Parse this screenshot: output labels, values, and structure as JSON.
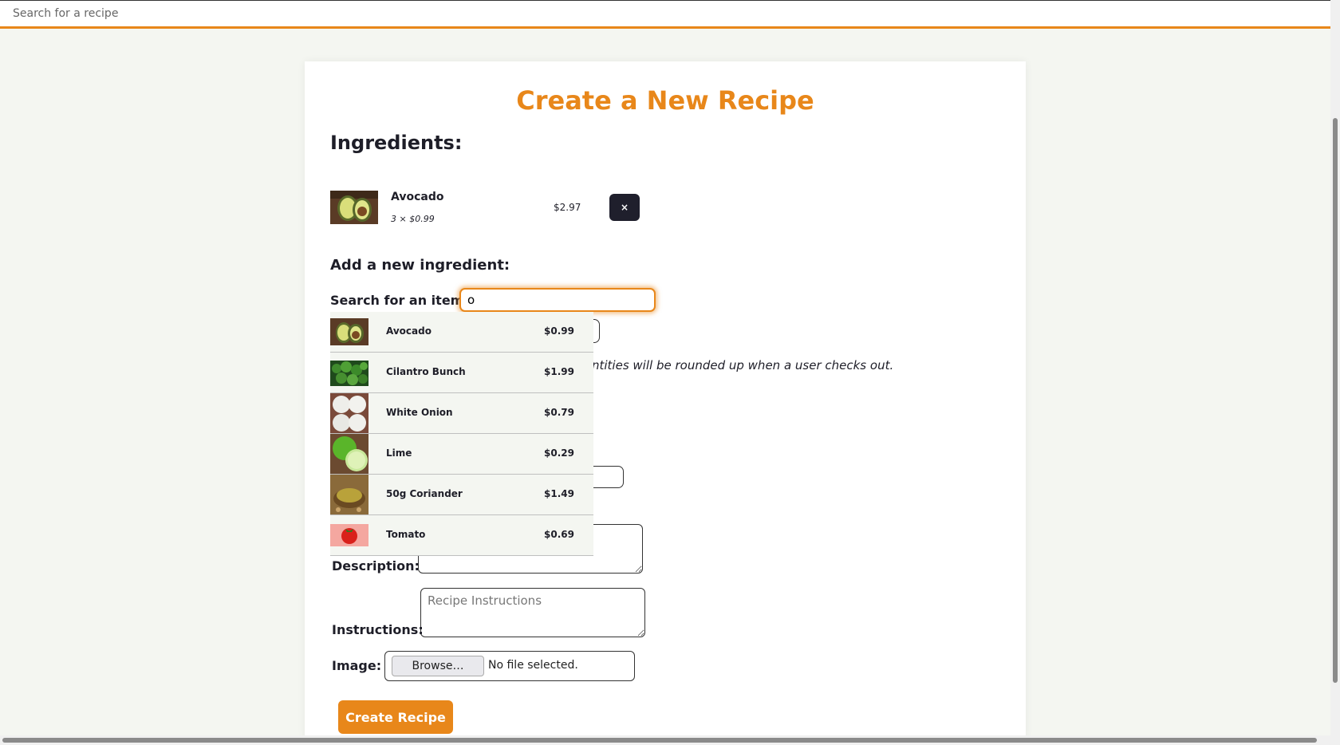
{
  "topbar": {
    "search_placeholder": "Search for a recipe"
  },
  "page": {
    "title": "Create a New Recipe"
  },
  "ingredients": {
    "heading": "Ingredients:",
    "items": [
      {
        "name": "Avocado",
        "quantity_line": "3 × $0.99",
        "total": "$2.97",
        "remove_label": "×",
        "image": "avocado"
      }
    ]
  },
  "add_ingredient": {
    "heading": "Add a new ingredient:",
    "search_label": "Search for an item:",
    "search_value": "o",
    "note_partial": "ntities will be rounded up when a user checks out."
  },
  "dropdown": {
    "items": [
      {
        "name": "Avocado",
        "price": "$0.99",
        "image": "avocado"
      },
      {
        "name": "Cilantro Bunch",
        "price": "$1.99",
        "image": "cilantro"
      },
      {
        "name": "White Onion",
        "price": "$0.79",
        "image": "onion"
      },
      {
        "name": "Lime",
        "price": "$0.29",
        "image": "lime"
      },
      {
        "name": "50g Coriander",
        "price": "$1.49",
        "image": "coriander"
      },
      {
        "name": "Tomato",
        "price": "$0.69",
        "image": "tomato"
      }
    ]
  },
  "form": {
    "description_label": "Description:",
    "instructions_label": "Instructions:",
    "instructions_placeholder": "Recipe Instructions",
    "image_label": "Image:",
    "browse_label": "Browse…",
    "file_status": "No file selected.",
    "submit_label": "Create Recipe"
  },
  "colors": {
    "accent": "#e8871a",
    "dark_button": "#1f1f2c",
    "page_bg": "#f4f6f1"
  }
}
